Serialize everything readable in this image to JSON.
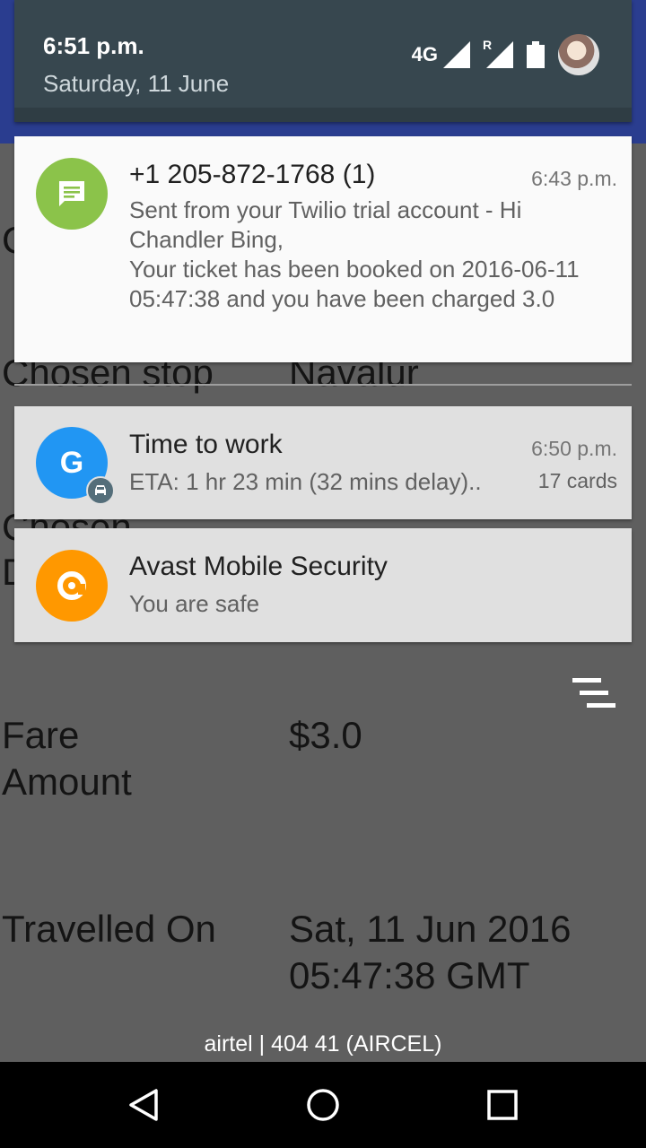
{
  "status": {
    "time": "6:51 p.m.",
    "date": "Saturday, 11 June",
    "network_label": "4G",
    "roaming_label": "R"
  },
  "background_app": {
    "row1_label": "Chosen stop",
    "row1_value": "Navalur",
    "row2_label": "Fare\nAmount",
    "row2_value": "$3.0",
    "row3_label": "Travelled On",
    "row3_value": "Sat, 11 Jun 2016\n05:47:38 GMT",
    "peek_chosen": "Chosen",
    "peek_d": "D",
    "peek_c": "C"
  },
  "notifications": [
    {
      "title": "+1 205-872-1768 (1)",
      "time": "6:43 p.m.",
      "body": "Sent from your Twilio trial account - Hi Chandler Bing,\n Your ticket has been booked on 2016-06-11 05:47:38 and you have been charged 3.0",
      "icon": "message-icon",
      "color": "#8bc34a"
    },
    {
      "title": "Time to work",
      "time": "6:50 p.m.",
      "body": "ETA: 1 hr 23 min (32 mins delay)..",
      "extra": "17 cards",
      "icon": "google-icon",
      "color": "#2196f3"
    },
    {
      "title": "Avast Mobile Security",
      "body": "You are safe",
      "icon": "avast-icon",
      "color": "#ff9800"
    }
  ],
  "google_letter": "G",
  "operator": "airtel | 404 41 (AIRCEL)"
}
